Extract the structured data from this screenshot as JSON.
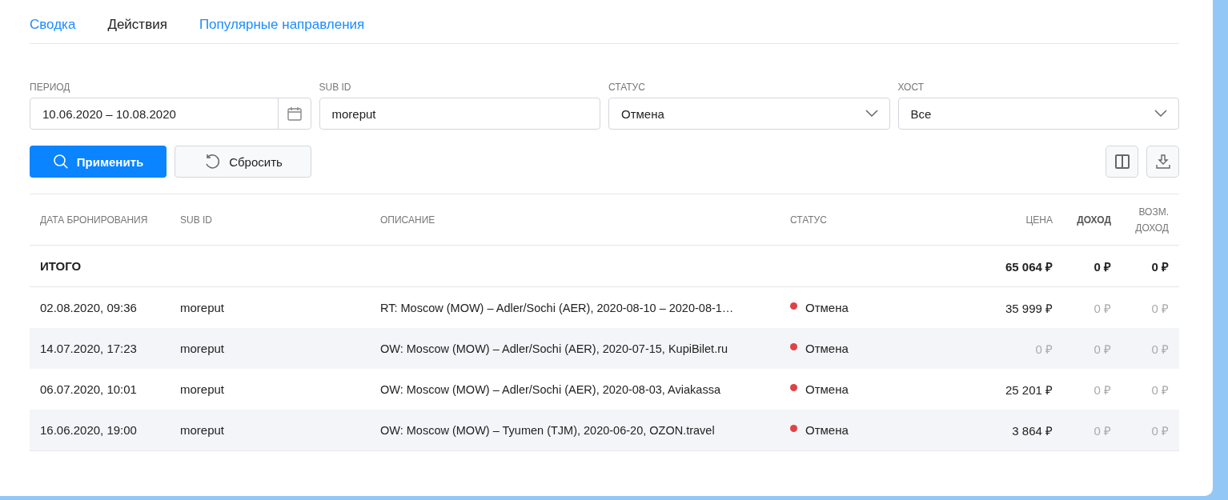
{
  "tabs": [
    {
      "label": "Сводка",
      "selected": false
    },
    {
      "label": "Действия",
      "selected": true
    },
    {
      "label": "Популярные направления",
      "selected": false
    }
  ],
  "filters": [
    {
      "kind": "date",
      "label": "ПЕРИОД",
      "value": "10.06.2020 – 10.08.2020"
    },
    {
      "kind": "text",
      "label": "SUB ID",
      "value": "moreput"
    },
    {
      "kind": "select",
      "label": "СТАТУС",
      "value": "Отмена"
    },
    {
      "kind": "select",
      "label": "ХОСТ",
      "value": "Все"
    }
  ],
  "buttons": [
    {
      "kind": "primary",
      "label": "Применить"
    },
    {
      "kind": "secondary",
      "label": "Сбросить"
    }
  ],
  "table": {
    "columns": [
      {
        "label": "ДАТА БРОНИРОВАНИЯ",
        "bold": false
      },
      {
        "label": "SUB ID",
        "bold": false
      },
      {
        "label": "ОПИСАНИЕ",
        "bold": false
      },
      {
        "label": "СТАТУС",
        "bold": false
      },
      {
        "label": "ЦЕНА",
        "bold": false
      },
      {
        "label": "ДОХОД",
        "bold": true
      },
      {
        "label": "ВОЗМ. ДОХОД",
        "bold": false
      }
    ],
    "total": {
      "label": "ИТОГО",
      "price": "65 064 ₽",
      "income": "0 ₽",
      "possible_income": "0 ₽"
    },
    "rows": [
      {
        "date": "02.08.2020, 09:36",
        "sub_id": "moreput",
        "description": "RT: Moscow (MOW) – Adler/Sochi (AER), 2020-08-10 – 2020-08-1…",
        "status": {
          "label": "Отмена",
          "color": "#e04146"
        },
        "price": {
          "value": "35 999 ₽",
          "muted": false
        },
        "income": {
          "value": "0 ₽",
          "muted": true
        },
        "possible_income": {
          "value": "0 ₽",
          "muted": true
        }
      },
      {
        "date": "14.07.2020, 17:23",
        "sub_id": "moreput",
        "description": "OW: Moscow (MOW) – Adler/Sochi (AER), 2020-07-15, KupiBilet.ru",
        "status": {
          "label": "Отмена",
          "color": "#e04146"
        },
        "price": {
          "value": "0 ₽",
          "muted": true
        },
        "income": {
          "value": "0 ₽",
          "muted": true
        },
        "possible_income": {
          "value": "0 ₽",
          "muted": true
        }
      },
      {
        "date": "06.07.2020, 10:01",
        "sub_id": "moreput",
        "description": "OW: Moscow (MOW) – Adler/Sochi (AER), 2020-08-03, Aviakassa",
        "status": {
          "label": "Отмена",
          "color": "#e04146"
        },
        "price": {
          "value": "25 201 ₽",
          "muted": false
        },
        "income": {
          "value": "0 ₽",
          "muted": true
        },
        "possible_income": {
          "value": "0 ₽",
          "muted": true
        }
      },
      {
        "date": "16.06.2020, 19:00",
        "sub_id": "moreput",
        "description": "OW: Moscow (MOW) – Tyumen (TJM), 2020-06-20, OZON.travel",
        "status": {
          "label": "Отмена",
          "color": "#e04146"
        },
        "price": {
          "value": "3 864 ₽",
          "muted": false
        },
        "income": {
          "value": "0 ₽",
          "muted": true
        },
        "possible_income": {
          "value": "0 ₽",
          "muted": true
        }
      }
    ]
  }
}
